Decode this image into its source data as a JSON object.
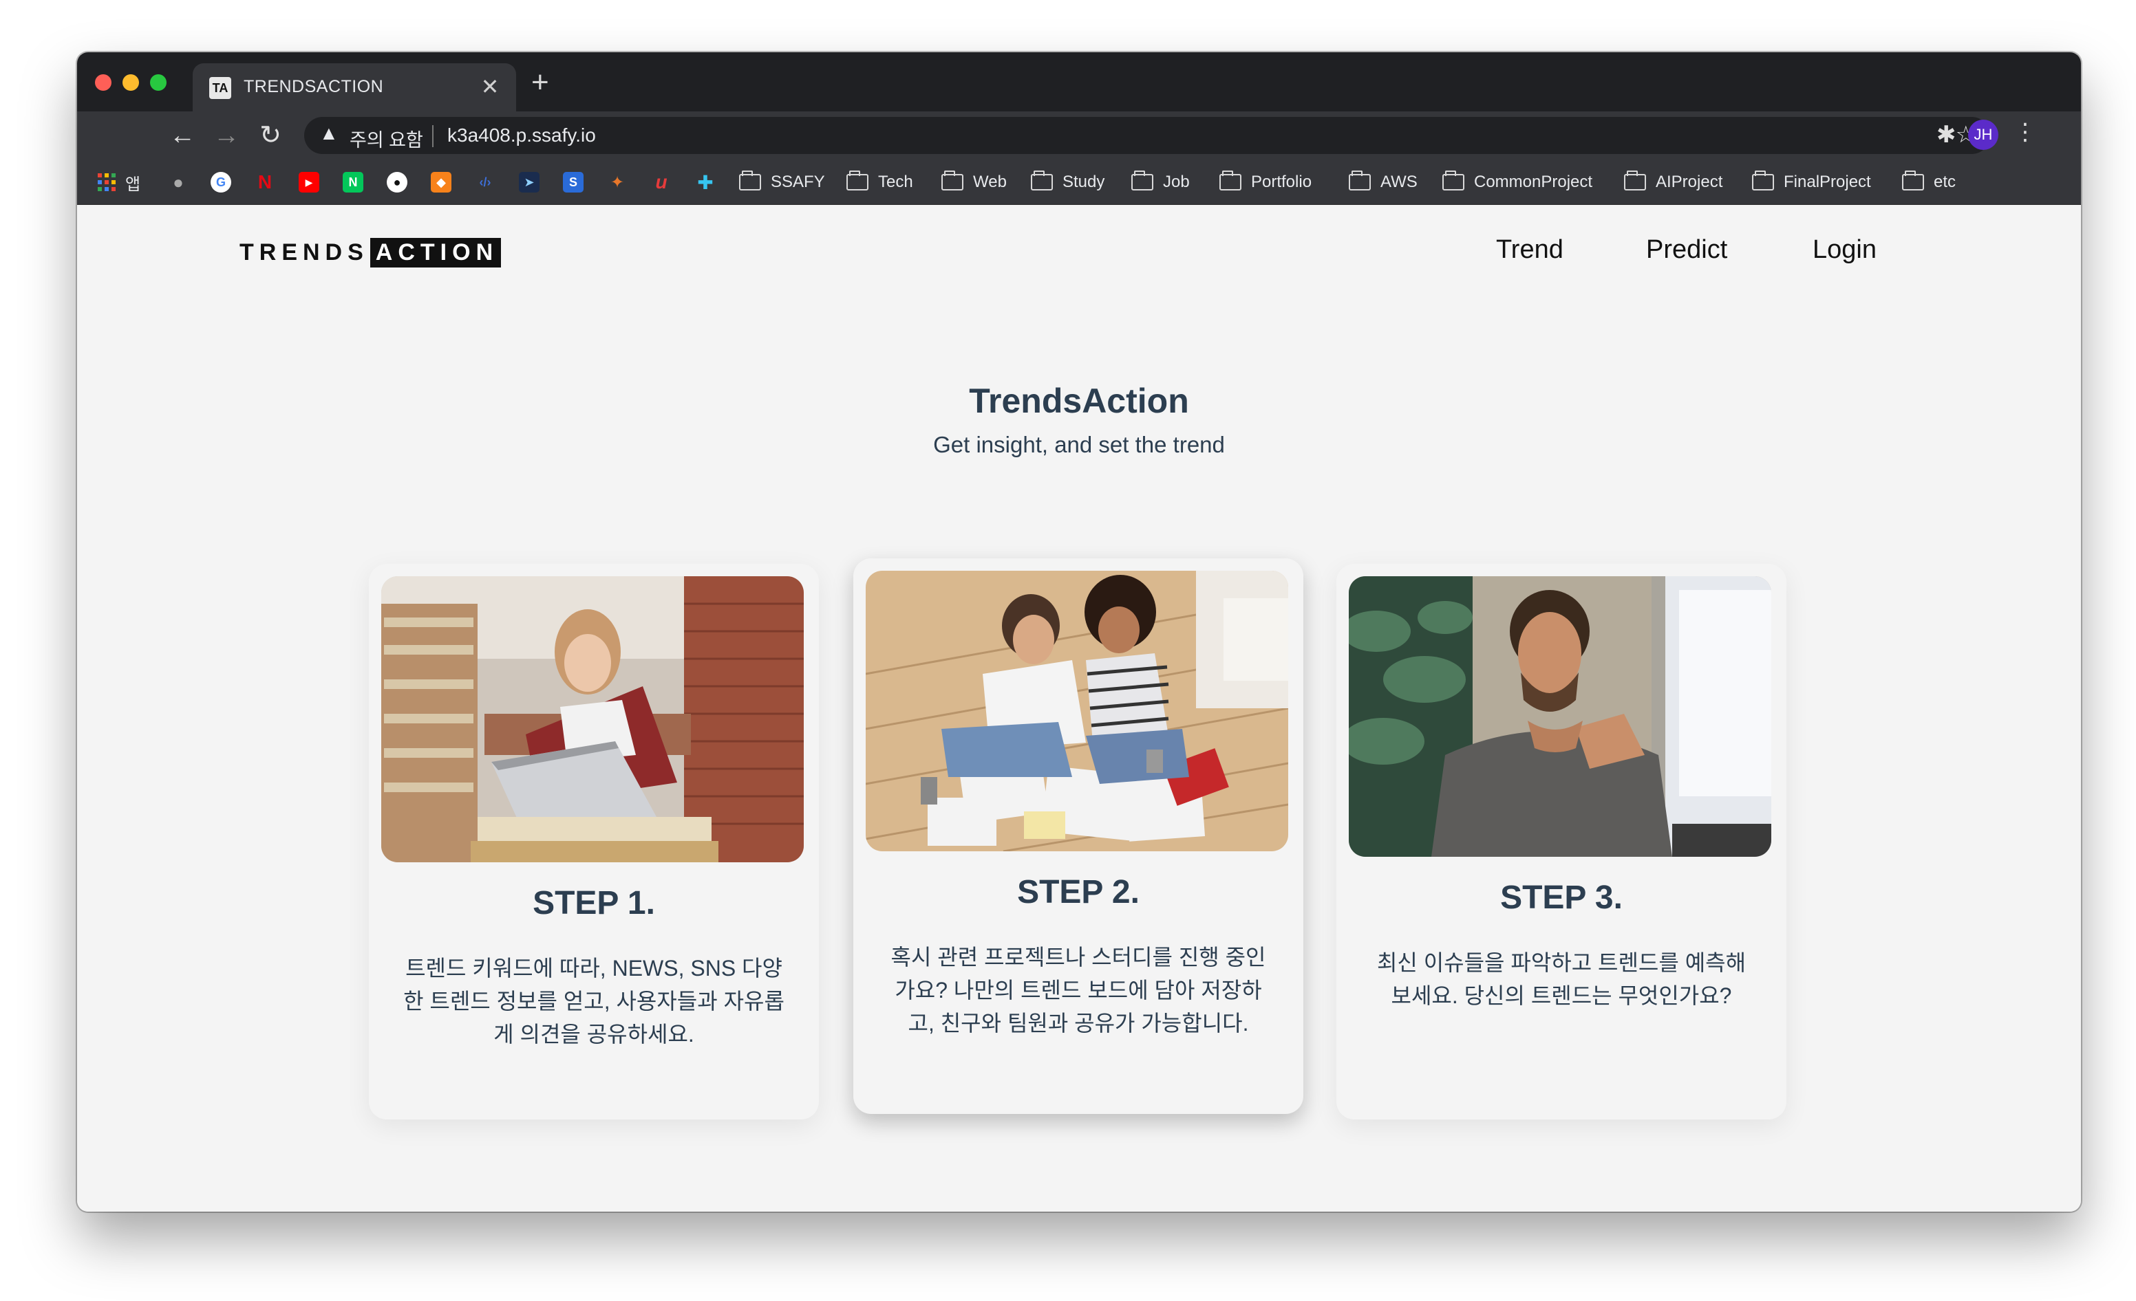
{
  "browser": {
    "tab_title": "TRENDSACTION",
    "tab_favicon": "TA",
    "close_glyph": "✕",
    "new_tab_glyph": "+",
    "security_label": "주의 요함",
    "url": "k3a408.p.ssafy.io",
    "profile_initials": "JH"
  },
  "bookmarks": {
    "apps_label": "앱",
    "folders": [
      "SSAFY",
      "Tech",
      "Web",
      "Study",
      "Job",
      "Portfolio",
      "AWS",
      "CommonProject",
      "AIProject",
      "FinalProject",
      "etc"
    ]
  },
  "site": {
    "logo_part1": "TRENDS",
    "logo_part2": "ACTION",
    "nav": [
      "Trend",
      "Predict",
      "Login"
    ],
    "hero_title": "TrendsAction",
    "hero_subtitle": "Get insight, and set the trend"
  },
  "steps": [
    {
      "title": "STEP 1.",
      "lines": [
        "트렌드 키워드에 따라, NEWS, SNS 다양",
        "한 트렌드 정보를 얻고, 사용자들과 자유롭",
        "게 의견을 공유하세요."
      ]
    },
    {
      "title": "STEP 2.",
      "lines": [
        "혹시 관련 프로젝트나 스터디를 진행 중인",
        "가요? 나만의 트렌드 보드에 담아 저장하",
        "고, 친구와 팀원과 공유가 가능합니다."
      ]
    },
    {
      "title": "STEP 3.",
      "lines": [
        "최신 이슈들을 파악하고 트렌드를 예측해",
        "보세요. 당신의 트렌드는 무엇인가요?"
      ]
    }
  ]
}
